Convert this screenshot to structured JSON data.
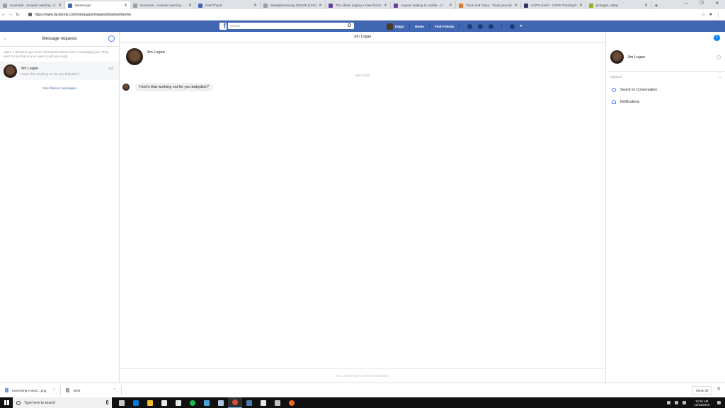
{
  "browser": {
    "tabs": [
      {
        "title": "Scammer , recaster warning - li",
        "color": "#9aa0a6",
        "active": false
      },
      {
        "title": "Messenger",
        "color": "#4267b2",
        "active": true
      },
      {
        "title": "Scammer , recaster warning - Li",
        "color": "#9aa0a6",
        "active": false
      },
      {
        "title": "Paul Thaxd",
        "color": "#4267b2",
        "active": false
      },
      {
        "title": "deregistered-png 812169 (12%)",
        "color": "#9aa0a6",
        "active": false
      },
      {
        "title": "The Aliens Legacy • View forum",
        "color": "#6a3fa0",
        "active": false
      },
      {
        "title": "Anyone looking to cuddle - cr",
        "color": "#6a3fa0",
        "active": false
      },
      {
        "title": "Track and Trace - Track your Ite",
        "color": "#e0762b",
        "active": false
      },
      {
        "title": "USPS.com® - USPS Tracking®",
        "color": "#333366",
        "active": false
      },
      {
        "title": "jimlogan | eBay",
        "color": "#86b817",
        "active": false
      }
    ],
    "url": "https://www.facebook.com/messages/requests/t/iamwolverine"
  },
  "fb_header": {
    "search_placeholder": "Search",
    "user_name": "Edgar",
    "home": "Home",
    "find_friends": "Find Friends"
  },
  "left_panel": {
    "title": "Message requests",
    "info": "Open a thread to get more information about who's messaging you. They won't know that you've seen it until you reply.",
    "thread": {
      "name": "Jim Logan",
      "preview": "How's that working out for you babydick?",
      "date": "Sat"
    },
    "filtered_link": "See filtered messages"
  },
  "conversation": {
    "header_name": "Jim Logan",
    "profile_name": "Jim Logan",
    "timestamp": "SAT 22:53",
    "message": "How's that working out for you babydick?",
    "footer": "You cannot reply to this conversation."
  },
  "right_panel": {
    "name": "Jim Logan",
    "options_label": "Options",
    "search_label": "Search in Conversation",
    "notifications_label": "Notifications"
  },
  "downloads": {
    "items": [
      "everything-i-need....png",
      "tshirt"
    ],
    "show_all": "Show all"
  },
  "taskbar": {
    "search_placeholder": "Type here to search",
    "time": "12:15 AM",
    "date": "12/23/2018",
    "apps": [
      "#c9c9c9",
      "#0078d7",
      "#f2c12e",
      "#e8e8e8",
      "#e8e8e8",
      "#1db954",
      "#4aa0d8",
      "#b0c4de",
      "#dd4b39",
      "#4b7bb0",
      "#e8e8e8",
      "#c0c0c0",
      "#f26522"
    ]
  }
}
